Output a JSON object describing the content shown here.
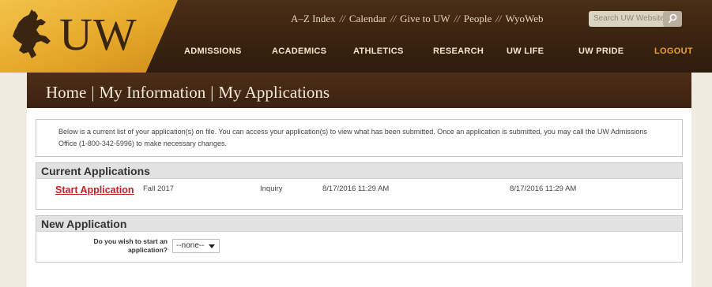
{
  "logo": {
    "text": "UW"
  },
  "utility_nav": {
    "items": [
      "A–Z Index",
      "Calendar",
      "Give to UW",
      "People",
      "WyoWeb"
    ],
    "separator": "//"
  },
  "search": {
    "placeholder": "Search UW Website"
  },
  "main_nav": [
    "ADMISSIONS",
    "ACADEMICS",
    "ATHLETICS",
    "RESEARCH",
    "UW LIFE",
    "UW PRIDE",
    "LOGOUT"
  ],
  "breadcrumb": {
    "items": [
      "Home",
      "My Information",
      "My Applications"
    ],
    "separator": "|"
  },
  "intro": "Below is a current list of your application(s) on file. You can access your application(s) to view what has been submitted. Once an application is submitted, you may call the UW Admissions Office (1-800-342-5996) to make necessary changes.",
  "current_applications": {
    "heading": "Current Applications",
    "rows": [
      {
        "action": "Start Application",
        "term": "Fall 2017",
        "status": "Inquiry",
        "created": "8/17/2016 11:29 AM",
        "updated": "8/17/2016 11:29 AM"
      }
    ]
  },
  "new_application": {
    "heading": "New Application",
    "question": "Do you wish to start an application?",
    "select_value": "--none--"
  },
  "colors": {
    "gold": "#e6a92a",
    "brown": "#3b2211",
    "logout": "#e8a322",
    "link_red": "#c42222"
  }
}
